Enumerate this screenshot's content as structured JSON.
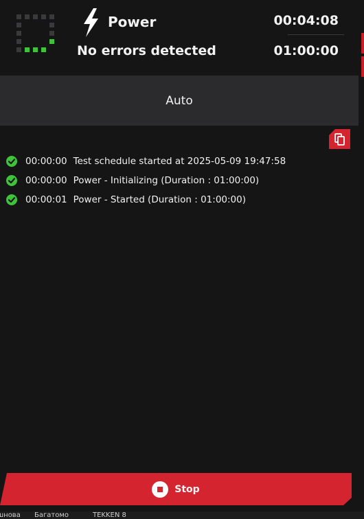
{
  "header": {
    "mode_name": "Power",
    "status": "No errors detected",
    "elapsed_time": "00:04:08",
    "total_time": "01:00:00"
  },
  "mode_selector": {
    "label": "Auto"
  },
  "log": {
    "entries": [
      {
        "time": "00:00:00",
        "message": "Test schedule started at 2025-05-09 19:47:58",
        "status": "success"
      },
      {
        "time": "00:00:00",
        "message": "Power - Initializing (Duration : 01:00:00)",
        "status": "success"
      },
      {
        "time": "00:00:01",
        "message": "Power - Started (Duration : 01:00:00)",
        "status": "success"
      }
    ]
  },
  "actions": {
    "stop_label": "Stop"
  },
  "taskbar": {
    "items": [
      "шнова",
      "Багатомо",
      "TEKKEN 8"
    ]
  },
  "icons": {
    "progress": "progress-spinner-icon",
    "mode": "lightning-bolt-icon",
    "copy": "copy-icon",
    "status": "check-circle-icon",
    "stop": "stop-circle-icon"
  },
  "colors": {
    "accent": "#d42430",
    "success": "#3ec43a",
    "background": "#151516",
    "panel": "#2b2b2e"
  }
}
